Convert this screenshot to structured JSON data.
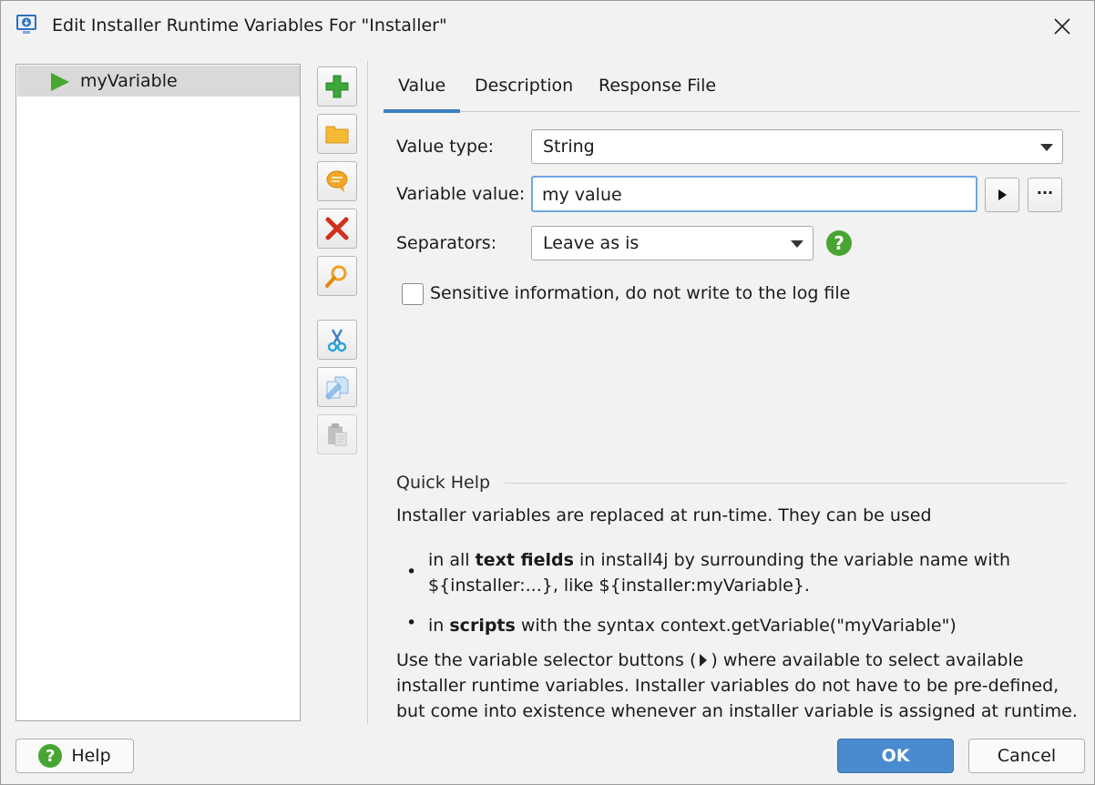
{
  "window": {
    "title": "Edit Installer Runtime Variables For \"Installer\""
  },
  "variables": [
    {
      "name": "myVariable"
    }
  ],
  "toolbar": {
    "buttons": [
      {
        "icon": "add-icon"
      },
      {
        "icon": "folder-icon"
      },
      {
        "icon": "comment-icon"
      },
      {
        "icon": "delete-icon"
      },
      {
        "icon": "search-icon"
      },
      {
        "icon": "cut-icon"
      },
      {
        "icon": "copy-icon"
      },
      {
        "icon": "paste-icon"
      }
    ]
  },
  "tabs": [
    {
      "label": "Value"
    },
    {
      "label": "Description"
    },
    {
      "label": "Response File"
    }
  ],
  "form": {
    "value_type_label": "Value type:",
    "value_type": "String",
    "variable_value_label": "Variable value:",
    "variable_value": "my value",
    "variable_selector_symbol": "▶",
    "more_button_label": "···",
    "separators_label": "Separators:",
    "separators_value": "Leave as is",
    "help_symbol": "?",
    "sensitive_label": "Sensitive information, do not write to the log file"
  },
  "quick_help": {
    "title": "Quick Help",
    "intro": "Installer variables are replaced at run-time. They can be used",
    "bullet1_pre": "in all ",
    "bullet1_bold": "text fields",
    "bullet1_post": " in install4j by surrounding the variable name with",
    "bullet1_line2": "${installer:...}, like ${installer:myVariable}.",
    "bullet2_pre": "in ",
    "bullet2_bold": "scripts",
    "bullet2_post": " with the syntax context.getVariable(\"myVariable\")",
    "outro1_pre": "Use the variable selector buttons (",
    "outro1_post": ") where available to select available",
    "outro2": "installer runtime variables. Installer variables do not have to be pre-defined,",
    "outro3": "but come into existence whenever an installer variable is assigned at runtime.",
    "bullet_symbol": "•"
  },
  "buttons": {
    "help": "Help",
    "ok": "OK",
    "cancel": "Cancel"
  },
  "colors": {
    "accent": "#3a7fc1",
    "ok_button": "#4a8bd0",
    "help_green": "#49a532"
  }
}
